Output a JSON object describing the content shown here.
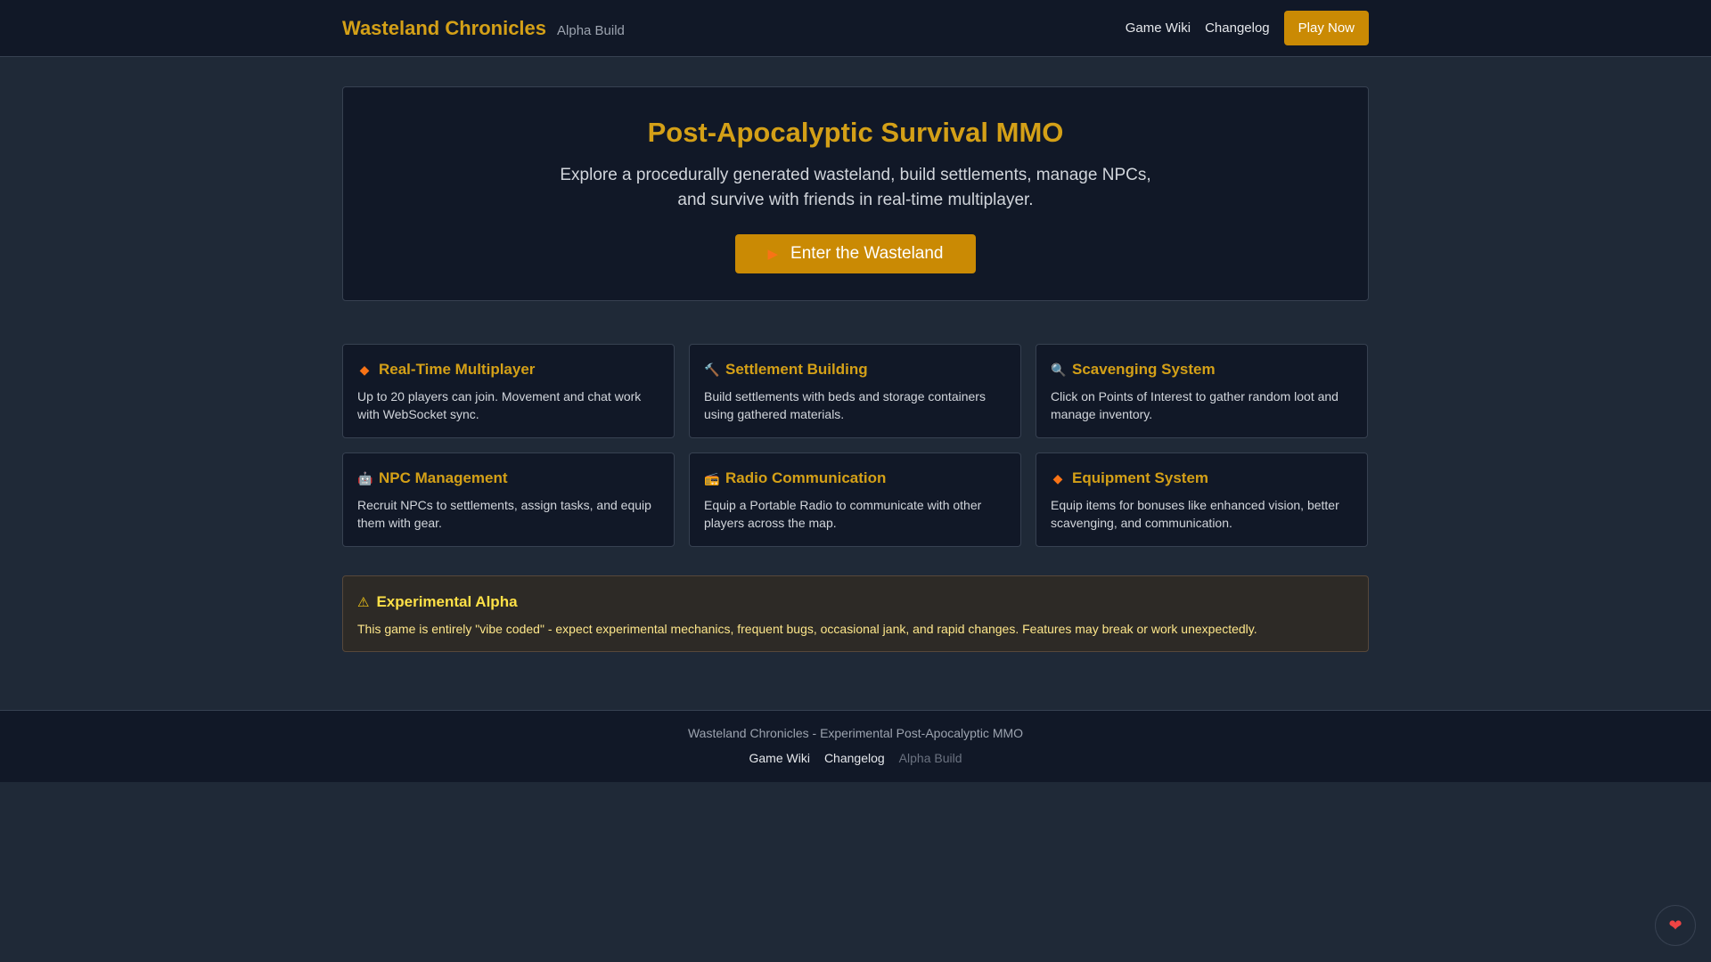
{
  "header": {
    "title": "Wasteland Chronicles",
    "subtitle": "Alpha Build",
    "nav": {
      "wiki": "Game Wiki",
      "changelog": "Changelog",
      "play": "Play Now"
    }
  },
  "hero": {
    "title": "Post-Apocalyptic Survival MMO",
    "desc_line1": "Explore a procedurally generated wasteland, build settlements, manage NPCs,",
    "desc_line2": "and survive with friends in real-time multiplayer.",
    "cta_icon": "▶",
    "cta_label": "Enter the Wasteland"
  },
  "features": [
    {
      "icon": "◆",
      "icon_name": "diamond-icon",
      "title": "Real-Time Multiplayer",
      "desc": "Up to 20 players can join. Movement and chat work with WebSocket sync."
    },
    {
      "icon": "🔨",
      "icon_name": "hammer-icon",
      "title": "Settlement Building",
      "desc": "Build settlements with beds and storage containers using gathered materials."
    },
    {
      "icon": "🔍",
      "icon_name": "magnifier-icon",
      "title": "Scavenging System",
      "desc": "Click on Points of Interest to gather random loot and manage inventory."
    },
    {
      "icon": "🤖",
      "icon_name": "robot-icon",
      "title": "NPC Management",
      "desc": "Recruit NPCs to settlements, assign tasks, and equip them with gear."
    },
    {
      "icon": "📻",
      "icon_name": "radio-icon",
      "title": "Radio Communication",
      "desc": "Equip a Portable Radio to communicate with other players across the map."
    },
    {
      "icon": "◆",
      "icon_name": "diamond-icon",
      "title": "Equipment System",
      "desc": "Equip items for bonuses like enhanced vision, better scavenging, and communication."
    }
  ],
  "alert": {
    "icon": "⚠",
    "title": "Experimental Alpha",
    "desc": "This game is entirely \"vibe coded\" - expect experimental mechanics, frequent bugs, occasional jank, and rapid changes. Features may break or work unexpectedly."
  },
  "footer": {
    "text": "Wasteland Chronicles - Experimental Post-Apocalyptic MMO",
    "wiki": "Game Wiki",
    "changelog": "Changelog",
    "build": "Alpha Build"
  },
  "fab": {
    "icon": "❤",
    "icon_name": "heart-icon"
  },
  "colors": {
    "accent": "#d4a017",
    "button": "#ca8a04",
    "background": "#1f2937",
    "panel": "#111827"
  }
}
